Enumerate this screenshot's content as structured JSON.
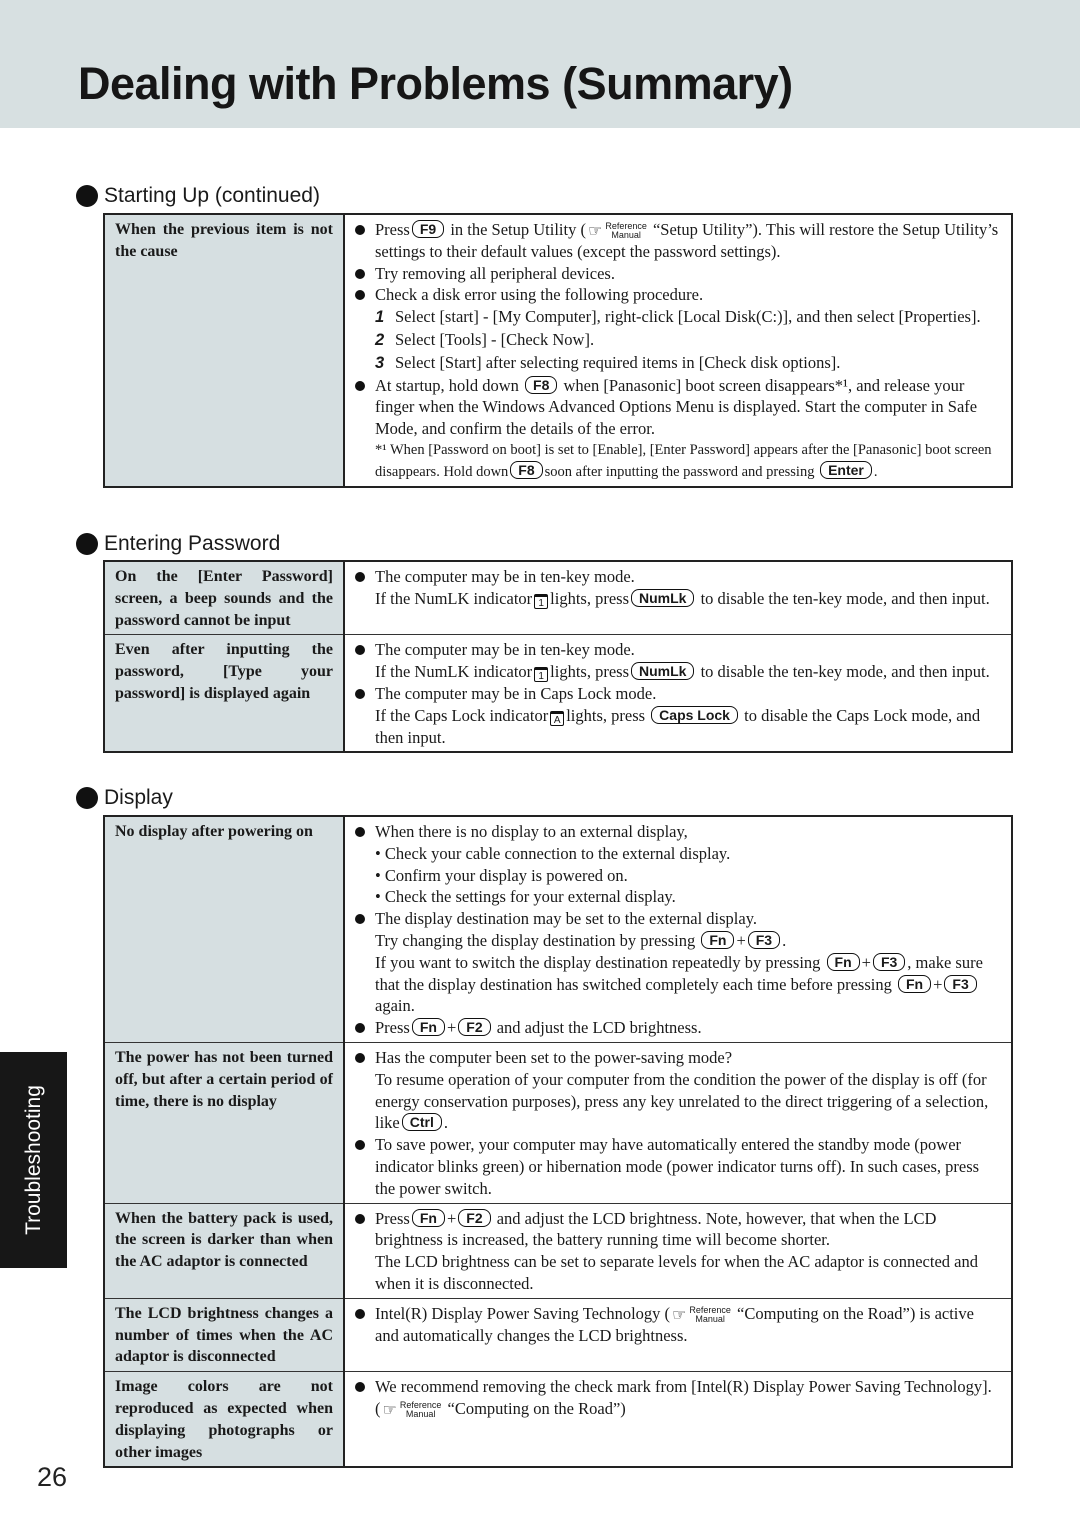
{
  "page": {
    "title": "Dealing with Problems (Summary)",
    "side_tab": "Troubleshooting",
    "page_number": "26",
    "colors": {
      "header_band": "#d7e0e1",
      "cause_cell": "#d6dfe1",
      "side_tab": "#171717"
    }
  },
  "ref": {
    "top": "Reference",
    "bottom": "Manual",
    "hand_icon": "pointing-hand-icon"
  },
  "sections": {
    "starting_up": {
      "heading": "Starting Up (continued)",
      "rows": [
        {
          "cause": "When the previous item is not the cause",
          "s1_pre": "Press",
          "s1_key": "F9",
          "s1_mid": "in the Setup Utility (",
          "s1_ref": "“Setup Utility”).  This will restore the Setup Utility’s settings to their default values (except the password settings).",
          "s2": "Try removing all peripheral devices.",
          "s3": "Check a disk error using the following procedure.",
          "steps": [
            {
              "n": "1",
              "text": "Select [start] - [My Computer], right-click [Local Disk(C:)], and then select [Properties]."
            },
            {
              "n": "2",
              "text": "Select [Tools] - [Check Now]."
            },
            {
              "n": "3",
              "text": "Select [Start] after selecting required items in [Check disk options]."
            }
          ],
          "s4_pre": "At startup, hold down",
          "s4_key": "F8",
          "s4_post": "when [Panasonic] boot screen disappears*¹, and release your finger when the Windows Advanced Options Menu is displayed.  Start the computer in Safe Mode, and confirm the details of the error.",
          "note_mark": "*¹",
          "note_pre": "When [Password on boot] is set to [Enable], [Enter Password] appears after the [Panasonic] boot screen disappears. Hold down",
          "note_key1": "F8",
          "note_mid": "soon after inputting the password and pressing",
          "note_key2": "Enter",
          "note_end": "."
        }
      ]
    },
    "entering_password": {
      "heading": "Entering Password",
      "rows": [
        {
          "cause": "On the [Enter Password] screen, a beep sounds and the password cannot be input",
          "s1": "The computer may be in ten-key mode.",
          "s1b_pre": "If the NumLK indicator",
          "s1b_icon": "1",
          "s1b_mid": "lights, press",
          "s1b_key": "NumLk",
          "s1b_post": "to disable the ten-key mode, and then input."
        },
        {
          "cause": "Even after inputting the password, [Type your password] is displayed again",
          "s1": "The computer may be in ten-key mode.",
          "s1b_pre": "If the NumLK indicator",
          "s1b_icon": "1",
          "s1b_mid": "lights, press",
          "s1b_key": "NumLk",
          "s1b_post": "to disable the ten-key mode, and then input.",
          "s2": "The computer may be in Caps Lock mode.",
          "s2b_pre": "If the Caps Lock indicator",
          "s2b_icon": "A",
          "s2b_mid": "lights, press",
          "s2b_key": "Caps Lock",
          "s2b_post": "to disable the Caps Lock mode, and then input."
        }
      ]
    },
    "display": {
      "heading": "Display",
      "rows": [
        {
          "cause": "No display after powering on",
          "s1": "When there is no display to an external display,",
          "s1_subs": [
            "• Check your cable connection to the external display.",
            "• Confirm your display is powered on.",
            "• Check the settings for your external display."
          ],
          "s2": "The display destination may be set to the external display.",
          "s2a_pre": "Try changing the display destination by pressing",
          "s2a_key1": "Fn",
          "s2a_plus": "+",
          "s2a_key2": "F3",
          "s2a_end": ".",
          "s2b_pre": "If you want to switch the display destination repeatedly by pressing",
          "s2b_key1": "Fn",
          "s2b_key2": "F3",
          "s2b_post": ", make sure that the display destination has switched completely each time before pressing",
          "s2b_key3": "Fn",
          "s2b_key4": "F3",
          "s2b_end": "again.",
          "s3_pre": "Press",
          "s3_key1": "Fn",
          "s3_key2": "F2",
          "s3_post": "and adjust the LCD brightness."
        },
        {
          "cause": "The power has not been turned off, but after a certain period of time, there is no display",
          "s1": "Has the computer been set to the power-saving mode?",
          "s1b_pre": "To resume operation of your computer from the condition the power of the display is off (for energy conservation purposes), press any key unrelated to the direct triggering of a selection, like",
          "s1b_key": "Ctrl",
          "s1b_end": ".",
          "s2": "To save power, your computer may have automatically entered the standby mode (power indicator blinks green) or hibernation mode (power indicator turns off).  In such cases, press the power switch."
        },
        {
          "cause": "When the battery pack is used, the screen is darker than when the AC adaptor is connected",
          "s1_pre": "Press",
          "s1_key1": "Fn",
          "s1_key2": "F2",
          "s1_post": "and adjust the LCD brightness.  Note, however, that when the LCD brightness is increased, the battery running time will become shorter.",
          "s1b": "The LCD brightness can be set to separate levels for when the AC adaptor is connected and when it is disconnected."
        },
        {
          "cause": "The LCD brightness changes a number of times when the AC adaptor is disconnected",
          "s1_pre": "Intel(R) Display Power Saving Technology (",
          "s1_post": "“Computing on the Road”) is active and automatically changes the LCD brightness."
        },
        {
          "cause": "Image colors are not reproduced as expected when displaying photographs or other images",
          "s1_pre": "We recommend removing the check mark from [Intel(R) Display Power Saving Technology]. (",
          "s1_post": "“Computing on the Road”)"
        }
      ]
    }
  }
}
